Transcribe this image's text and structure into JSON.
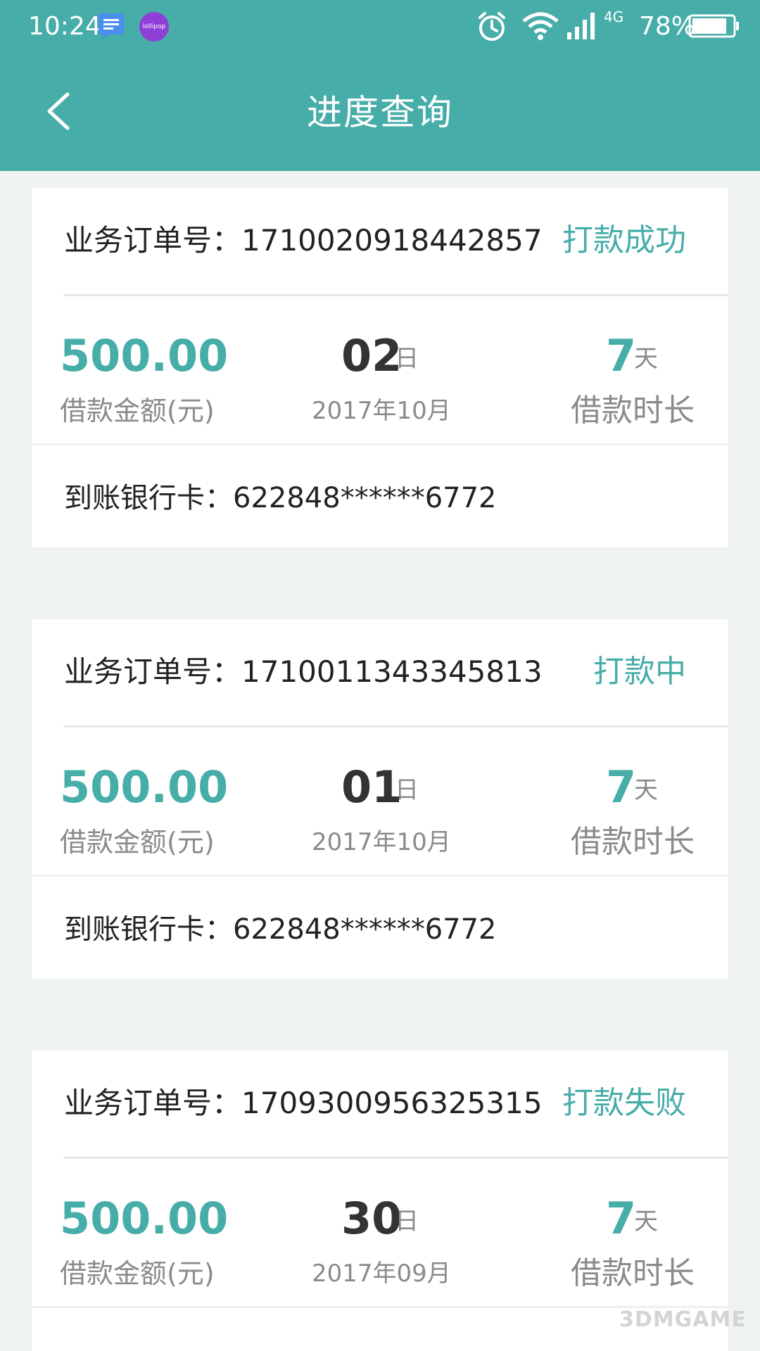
{
  "status_bar": {
    "time": "10:24",
    "network": "4G",
    "battery": "78%",
    "lollipop_badge": "lollipop",
    "icons": [
      "message-icon",
      "lollipop-icon",
      "alarm-icon",
      "wifi-icon",
      "signal-icon",
      "battery-icon"
    ]
  },
  "header": {
    "title": "进度查询",
    "back_icon": "chevron-left-icon"
  },
  "orders": [
    {
      "label": "业务订单号：",
      "number": "1710020918442857",
      "status": "打款成功",
      "amount": "500.00",
      "amount_label": "借款金额(元)",
      "day": "02",
      "day_unit": "日",
      "month": "2017年10月",
      "term": "7",
      "term_unit": "天",
      "term_label": "借款时长",
      "bank_label": "到账银行卡：",
      "bank_card": "622848******6772"
    },
    {
      "label": "业务订单号：",
      "number": "1710011343345813",
      "status": "打款中",
      "amount": "500.00",
      "amount_label": "借款金额(元)",
      "day": "01",
      "day_unit": "日",
      "month": "2017年10月",
      "term": "7",
      "term_unit": "天",
      "term_label": "借款时长",
      "bank_label": "到账银行卡：",
      "bank_card": "622848******6772"
    },
    {
      "label": "业务订单号：",
      "number": "1709300956325315",
      "status": "打款失败",
      "amount": "500.00",
      "amount_label": "借款金额(元)",
      "day": "30",
      "day_unit": "日",
      "month": "2017年09月",
      "term": "7",
      "term_unit": "天",
      "term_label": "借款时长"
    }
  ],
  "watermark": "3DMGAME",
  "colors": {
    "accent": "#47ada9",
    "background": "#eff3f2",
    "muted_text": "#8a8a8a"
  }
}
